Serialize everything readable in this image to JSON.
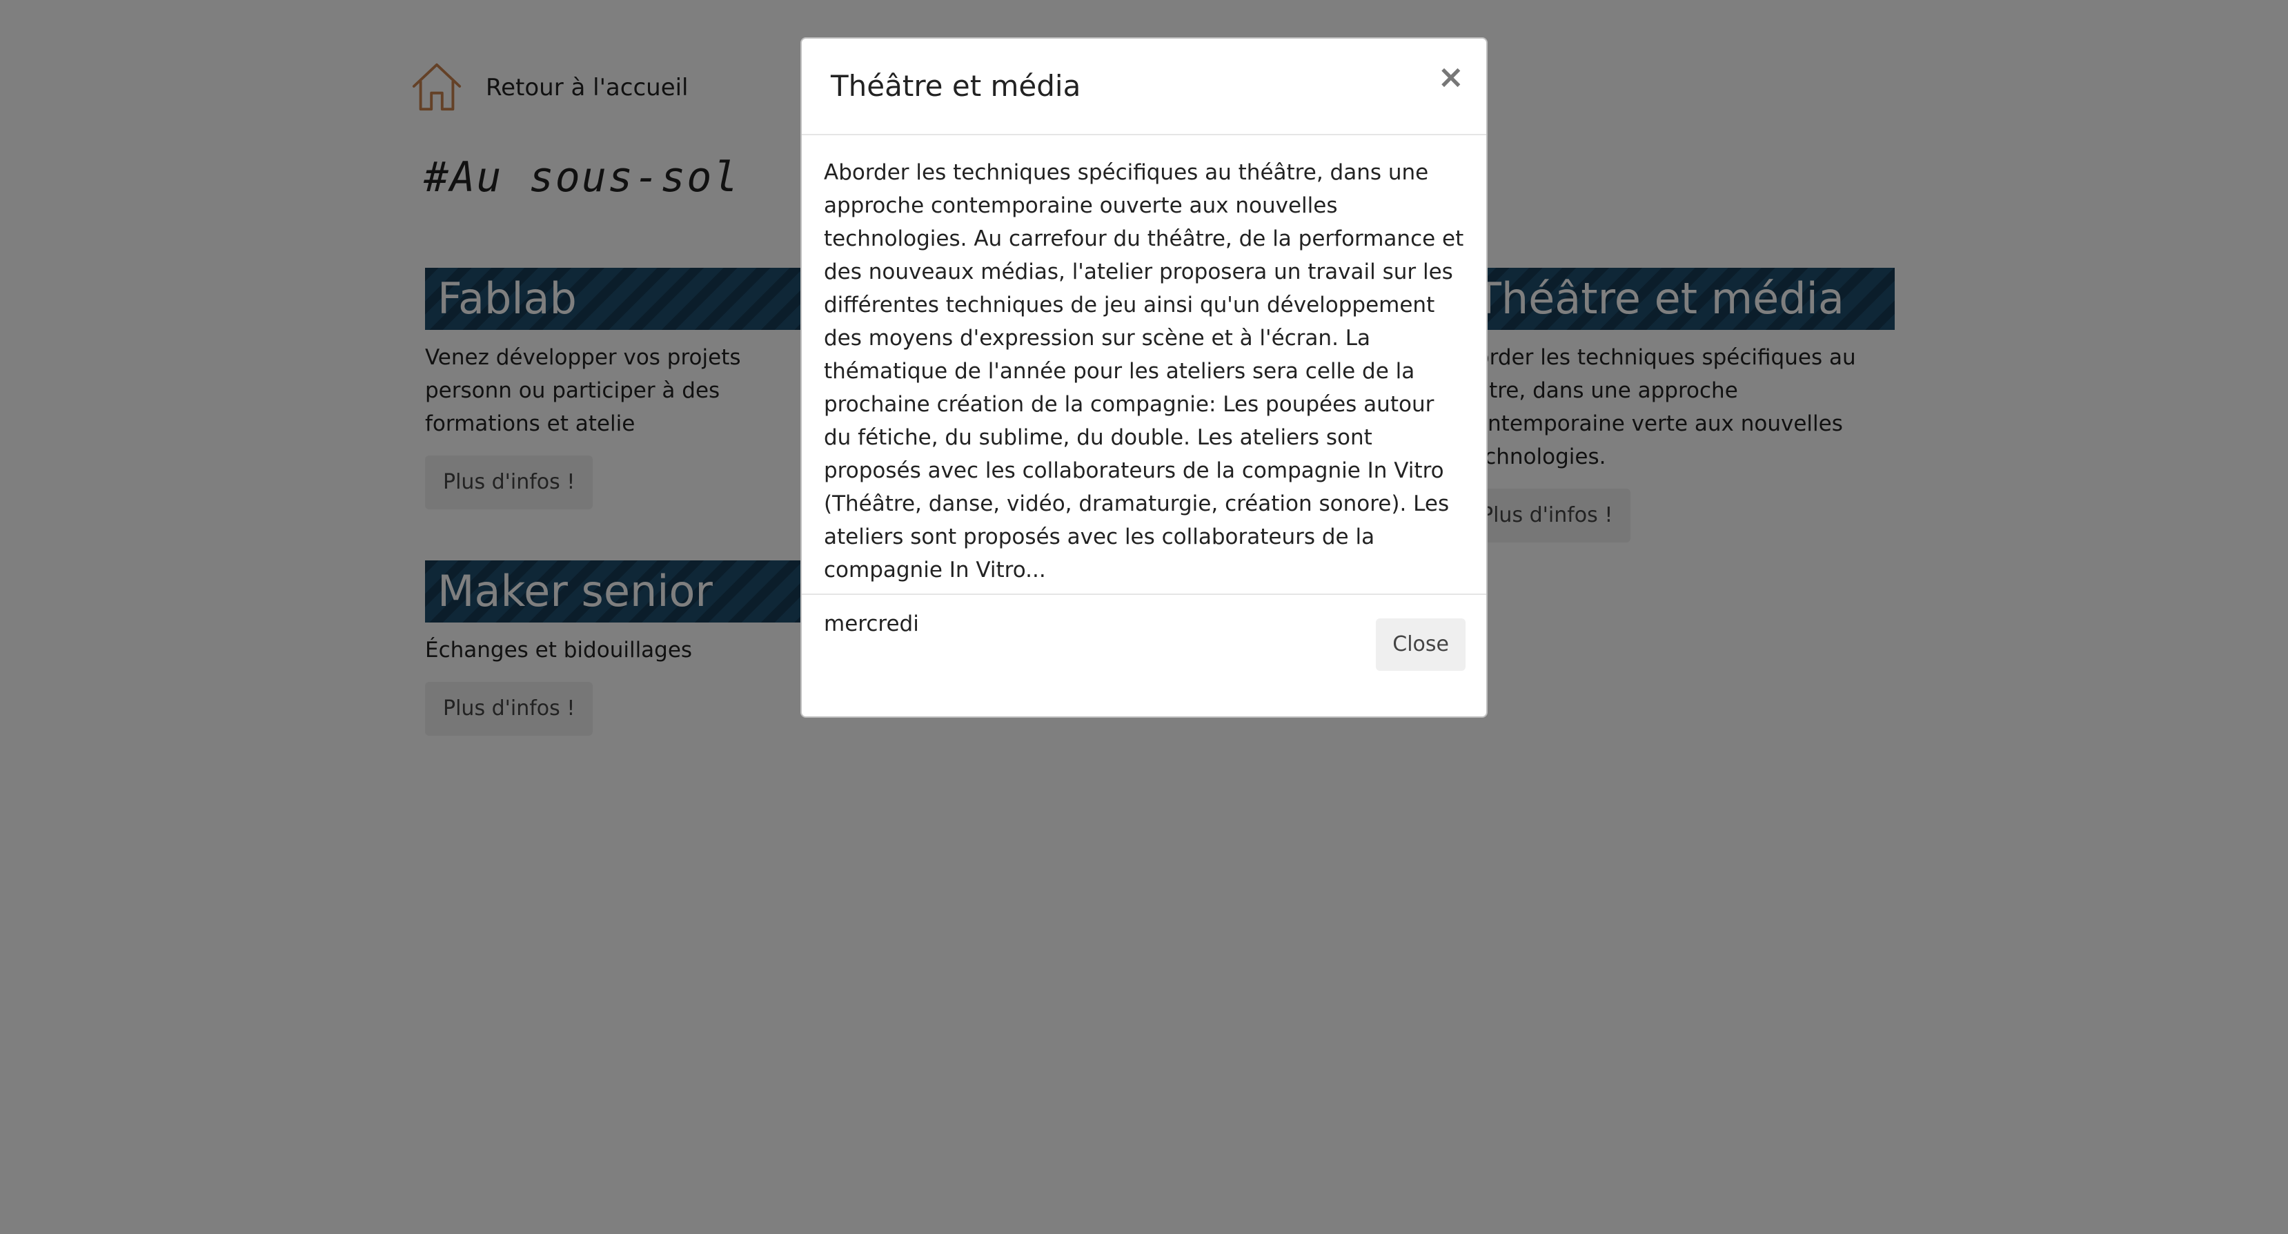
{
  "header": {
    "home_label": "Retour à l'accueil",
    "section_title": "#Au sous-sol"
  },
  "cards": [
    {
      "title": "Fablab",
      "description": "Venez développer vos projets personn ou participer à des formations et atelie",
      "button": "Plus d'infos !"
    },
    {
      "title": "Maker senior",
      "description": "Échanges et bidouillages",
      "button": "Plus d'infos !"
    },
    {
      "title": "Théâtre et média",
      "description": "border les techniques spécifiques au éâtre, dans une approche contemporaine verte aux nouvelles technologies.",
      "button": "Plus d'infos !"
    }
  ],
  "modal": {
    "title": "Théâtre et média",
    "close_symbol": "×",
    "body": "Aborder les techniques spécifiques au théâtre, dans une approche contemporaine ouverte aux nouvelles technologies. Au carrefour du théâtre, de la performance et des nouveaux médias, l'atelier proposera un travail sur les différentes techniques de jeu ainsi qu'un développement des moyens d'expression sur scène et à l'écran. La thématique de l'année pour les ateliers sera celle de la prochaine création de la compagnie: Les poupées autour du fétiche, du sublime, du double. Les ateliers sont proposés avec les collaborateurs de la compagnie In Vitro (Théâtre, danse, vidéo, dramaturgie, création sonore). Les ateliers sont proposés avec les collaborateurs de la compagnie In Vitro...",
    "day": "mercredi",
    "close_button": "Close"
  },
  "colors": {
    "title_bar": "#1f4e6f",
    "home_icon": "#c8834f",
    "overlay": "rgba(0,0,0,0.5)"
  },
  "icons": {
    "home": "home-icon"
  }
}
